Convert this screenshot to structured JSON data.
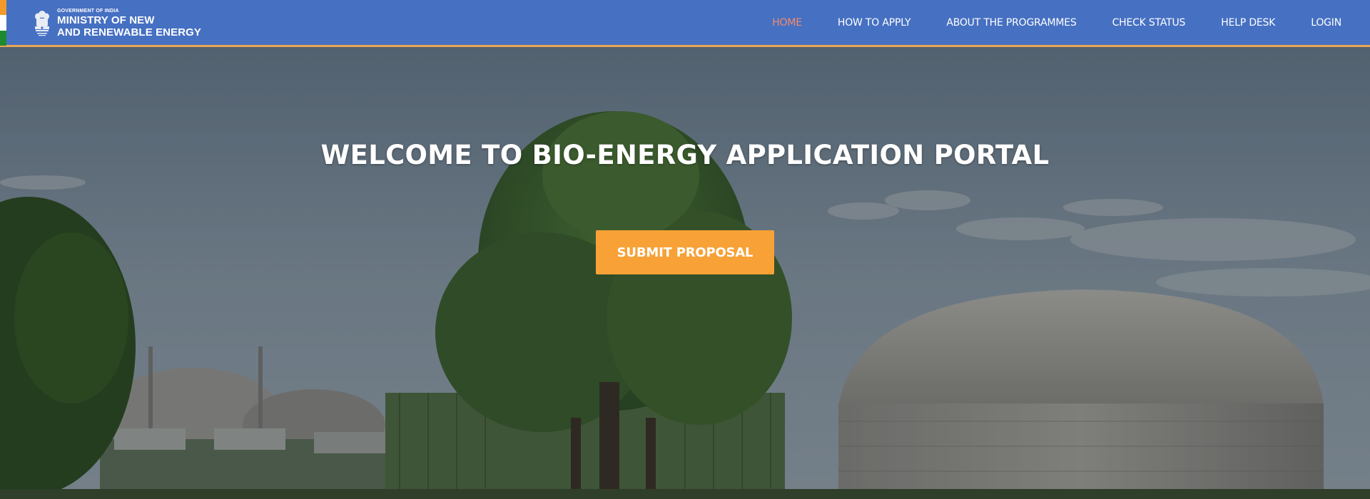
{
  "header": {
    "org_line_small": "GOVERNMENT OF INDIA",
    "org_line_1": "MINISTRY OF NEW",
    "org_line_2": "AND RENEWABLE ENERGY",
    "nav": [
      {
        "label": "HOME",
        "active": true
      },
      {
        "label": "HOW TO APPLY",
        "active": false
      },
      {
        "label": "ABOUT THE PROGRAMMES",
        "active": false
      },
      {
        "label": "CHECK STATUS",
        "active": false
      },
      {
        "label": "HELP DESK",
        "active": false
      },
      {
        "label": "LOGIN",
        "active": false
      }
    ],
    "colors": {
      "bar": "#4670c2",
      "border": "#e9a756",
      "active_link": "#f58b6b"
    }
  },
  "hero": {
    "title": "WELCOME TO BIO-ENERGY APPLICATION PORTAL",
    "cta_label": "SUBMIT PROPOSAL",
    "cta_color": "#f8a136",
    "background_description_icon": "biogas-plant-photo"
  }
}
